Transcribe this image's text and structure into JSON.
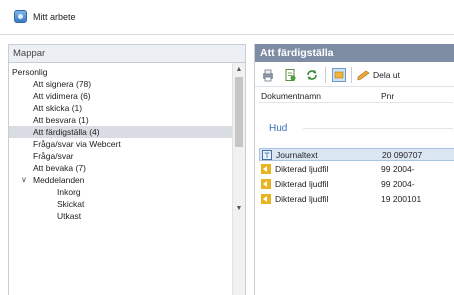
{
  "window": {
    "title": "Mitt arbete"
  },
  "left_panel": {
    "header": "Mappar",
    "items": [
      {
        "label": "Personlig",
        "level": 0
      },
      {
        "label": "Att signera (78)",
        "level": 1
      },
      {
        "label": "Att vidimera (6)",
        "level": 1
      },
      {
        "label": "Att skicka (1)",
        "level": 1
      },
      {
        "label": "Att besvara (1)",
        "level": 1
      },
      {
        "label": "Att färdigställa (4)",
        "level": 1,
        "selected": true
      },
      {
        "label": "Fråga/svar via Webcert",
        "level": 1
      },
      {
        "label": "Fråga/svar",
        "level": 1
      },
      {
        "label": "Att bevaka (7)",
        "level": 1
      },
      {
        "label": "Meddelanden",
        "level": 1,
        "expanded": true
      },
      {
        "label": "Inkorg",
        "level": 2
      },
      {
        "label": "Skickat",
        "level": 2
      },
      {
        "label": "Utkast",
        "level": 2
      }
    ]
  },
  "right_panel": {
    "header": "Att färdigställa",
    "toolbar": {
      "icons": [
        "printer-icon",
        "document-icon",
        "refresh-icon",
        "view-toggle-icon",
        "pencil-icon"
      ],
      "dela_label": "Dela ut"
    },
    "columns": {
      "name": "Dokumentnamn",
      "pnr": "Pnr"
    },
    "group": "Hud",
    "rows": [
      {
        "name": "Journaltext",
        "pnr": "20 090707",
        "icon": "journal-icon",
        "selected": true
      },
      {
        "name": "Dikterad ljudfil",
        "pnr": "99 2004-",
        "icon": "audio-icon"
      },
      {
        "name": "Dikterad ljudfil",
        "pnr": "99 2004-",
        "icon": "audio-icon"
      },
      {
        "name": "Dikterad ljudfil",
        "pnr": "19 200101",
        "icon": "audio-icon"
      }
    ]
  },
  "colors": {
    "header_bg": "#7e8da3",
    "selected_row": "#dbe6f3",
    "group_label": "#3a6fb0"
  }
}
